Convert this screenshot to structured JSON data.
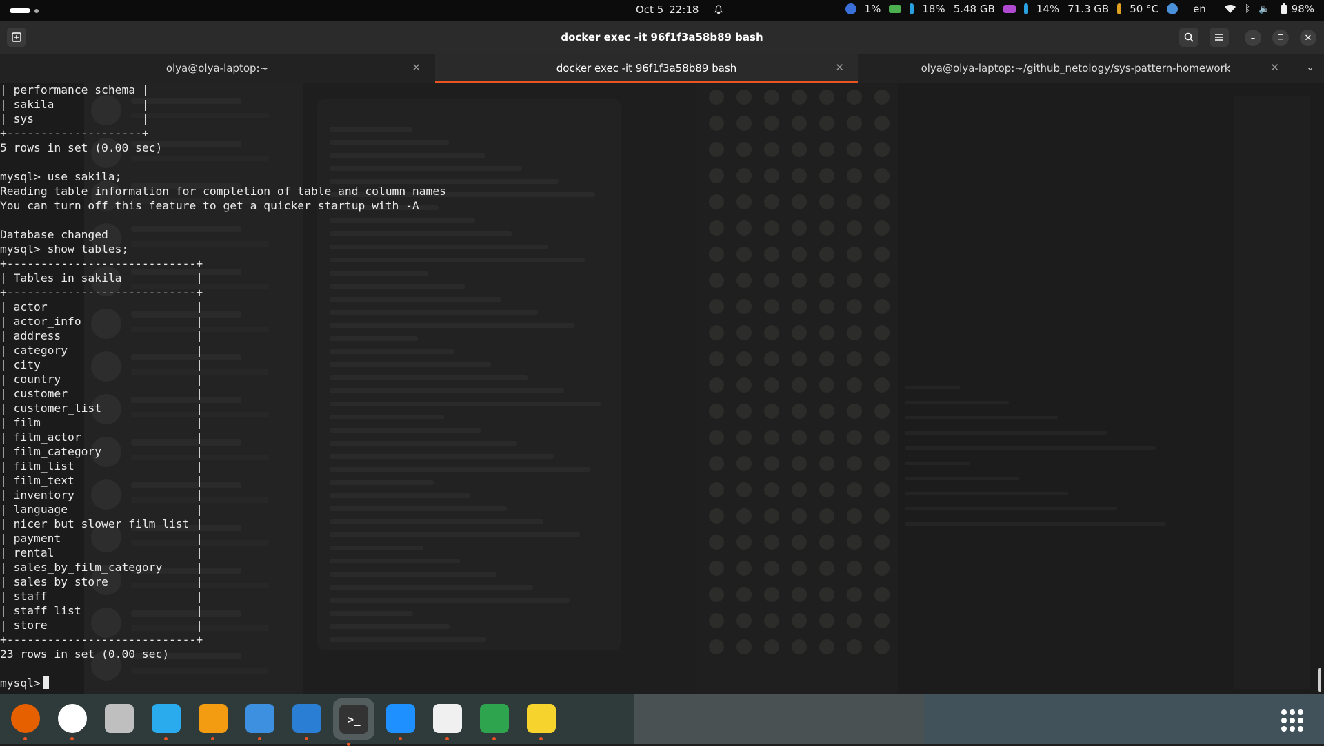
{
  "topbar": {
    "date": "Oct 5",
    "time": "22:18",
    "cpu": "1%",
    "mem": "18%",
    "mem_size": "5.48 GB",
    "disk": "14%",
    "disk_size": "71.3 GB",
    "temp": "50 °C",
    "lang": "en",
    "battery": "98%"
  },
  "window": {
    "title": "docker exec -it 96f1f3a58b89 bash"
  },
  "tabs": [
    {
      "label": "olya@olya-laptop:~"
    },
    {
      "label": "docker exec -it 96f1f3a58b89 bash"
    },
    {
      "label": "olya@olya-laptop:~/github_netology/sys-pattern-homework"
    }
  ],
  "terminal": {
    "lines": [
      "| performance_schema |",
      "| sakila             |",
      "| sys                |",
      "+--------------------+",
      "5 rows in set (0.00 sec)",
      "",
      "mysql> use sakila;",
      "Reading table information for completion of table and column names",
      "You can turn off this feature to get a quicker startup with -A",
      "",
      "Database changed",
      "mysql> show tables;",
      "+----------------------------+",
      "| Tables_in_sakila           |",
      "+----------------------------+",
      "| actor                      |",
      "| actor_info                 |",
      "| address                    |",
      "| category                   |",
      "| city                       |",
      "| country                    |",
      "| customer                   |",
      "| customer_list              |",
      "| film                       |",
      "| film_actor                 |",
      "| film_category              |",
      "| film_list                  |",
      "| film_text                  |",
      "| inventory                  |",
      "| language                   |",
      "| nicer_but_slower_film_list |",
      "| payment                    |",
      "| rental                     |",
      "| sales_by_film_category     |",
      "| sales_by_store             |",
      "| staff                      |",
      "| staff_list                 |",
      "| store                      |",
      "+----------------------------+",
      "23 rows in set (0.00 sec)",
      ""
    ],
    "prompt": "mysql>"
  },
  "dock": {
    "apps": [
      {
        "name": "firefox-icon",
        "glyph": "",
        "color": "#e66000"
      },
      {
        "name": "chrome-icon",
        "glyph": "",
        "color": "#ffffff"
      },
      {
        "name": "files-icon",
        "glyph": "",
        "color": "#bfbfbf"
      },
      {
        "name": "telegram-icon",
        "glyph": "",
        "color": "#2aabee"
      },
      {
        "name": "remote-desktop-icon",
        "glyph": "",
        "color": "#f39c12"
      },
      {
        "name": "screenshot-tool-icon",
        "glyph": "",
        "color": "#3d8fe0"
      },
      {
        "name": "system-monitor-icon",
        "glyph": "",
        "color": "#2a7fd4"
      },
      {
        "name": "terminal-icon",
        "glyph": ">_",
        "color": "#333333"
      },
      {
        "name": "vscode-icon",
        "glyph": "",
        "color": "#1e90ff"
      },
      {
        "name": "inkscape-icon",
        "glyph": "",
        "color": "#f0f0f0"
      },
      {
        "name": "spreadsheet-icon",
        "glyph": "",
        "color": "#2ea44f"
      },
      {
        "name": "text-editor-icon",
        "glyph": "",
        "color": "#f6d32d"
      }
    ]
  }
}
